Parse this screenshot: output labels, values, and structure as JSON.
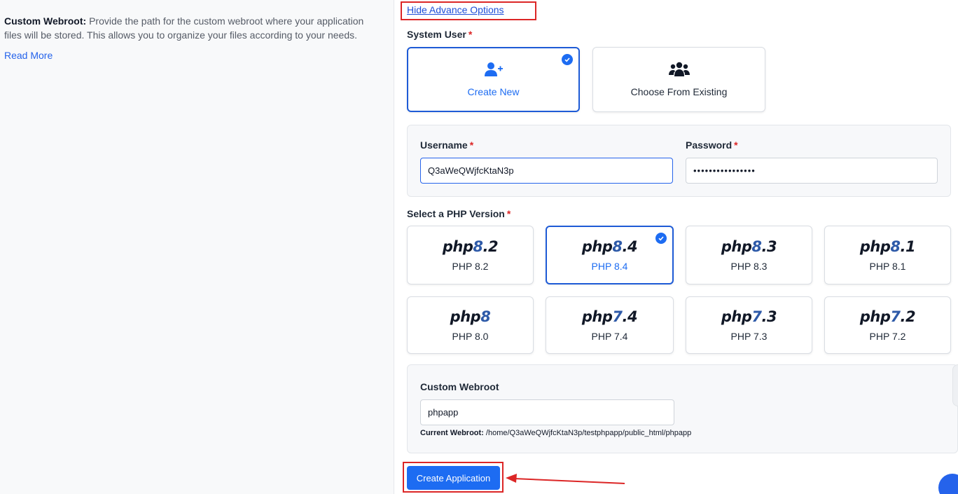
{
  "left": {
    "desc_title": "Custom Webroot:",
    "desc_text": "Provide the path for the custom webroot where your application files will be stored. This allows you to organize your files according to your needs.",
    "read_more": "Read More"
  },
  "advanced_toggle": "Hide Advance Options",
  "system_user": {
    "label": "System User",
    "required_mark": "*",
    "options": [
      {
        "label": "Create New",
        "icon": "user-plus-icon",
        "selected": true
      },
      {
        "label": "Choose From Existing",
        "icon": "users-icon",
        "selected": false
      }
    ]
  },
  "credentials": {
    "username_label": "Username",
    "password_label": "Password",
    "required_mark": "*",
    "username_value": "Q3aWeQWjfcKtaN3p",
    "password_value": "••••••••••••••••"
  },
  "php": {
    "label": "Select a PHP Version",
    "required_mark": "*",
    "versions": [
      {
        "logo_major": "8",
        "logo_minor": ".2",
        "label": "PHP 8.2",
        "selected": false
      },
      {
        "logo_major": "8",
        "logo_minor": ".4",
        "label": "PHP 8.4",
        "selected": true
      },
      {
        "logo_major": "8",
        "logo_minor": ".3",
        "label": "PHP 8.3",
        "selected": false
      },
      {
        "logo_major": "8",
        "logo_minor": ".1",
        "label": "PHP 8.1",
        "selected": false
      },
      {
        "logo_major": "8",
        "logo_minor": "",
        "label": "PHP 8.0",
        "selected": false
      },
      {
        "logo_major": "7",
        "logo_minor": ".4",
        "label": "PHP 7.4",
        "selected": false
      },
      {
        "logo_major": "7",
        "logo_minor": ".3",
        "label": "PHP 7.3",
        "selected": false
      },
      {
        "logo_major": "7",
        "logo_minor": ".2",
        "label": "PHP 7.2",
        "selected": false
      }
    ],
    "logo_prefix": "php"
  },
  "webroot": {
    "label": "Custom Webroot",
    "value": "phpapp",
    "current_label": "Current Webroot:",
    "current_path": "/home/Q3aWeQWjfcKtaN3p/testphpapp/public_html/phpapp"
  },
  "create_button": "Create Application",
  "colors": {
    "accent": "#1d6cf2",
    "annotation": "#dc2626"
  }
}
